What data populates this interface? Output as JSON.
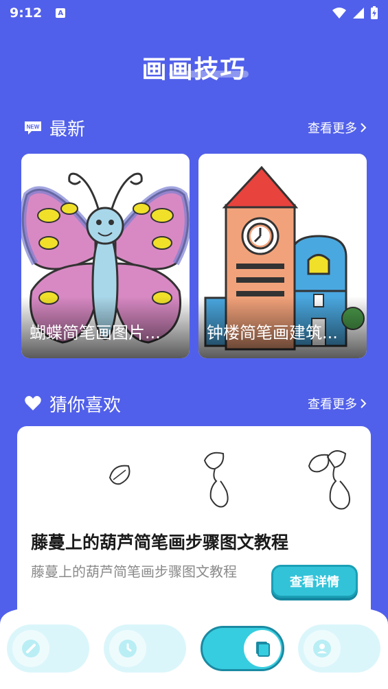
{
  "status": {
    "time": "9:12",
    "a_badge": "A"
  },
  "header": {
    "title": "画画技巧"
  },
  "latest": {
    "badge": "NEW",
    "title": "最新",
    "more_label": "查看更多",
    "cards": [
      {
        "title": "蝴蝶简笔画图片..."
      },
      {
        "title": "钟楼简笔画建筑..."
      }
    ]
  },
  "guess": {
    "title": "猜你喜欢",
    "more_label": "查看更多",
    "item": {
      "title": "藤蔓上的葫芦简笔画步骤图文教程",
      "desc": "藤蔓上的葫芦简笔画步骤图文教程",
      "button": "查看详情"
    }
  },
  "nav": {
    "items": [
      {
        "icon": "brush-icon"
      },
      {
        "icon": "clock-icon"
      },
      {
        "icon": "book-icon",
        "active": true
      },
      {
        "icon": "user-icon"
      }
    ]
  },
  "colors": {
    "background": "#5160ea",
    "accent": "#37cde0",
    "nav_bg": "#ffffff"
  }
}
